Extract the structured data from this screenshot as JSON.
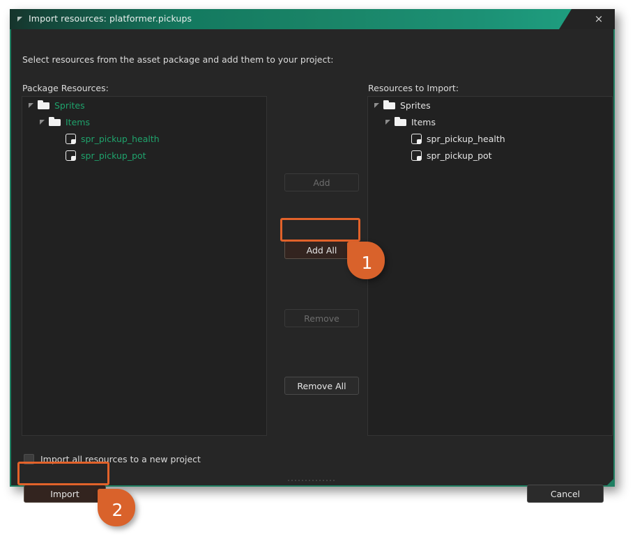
{
  "window": {
    "title": "Import resources: platformer.pickups",
    "menu_icon": "window-menu-triangle-icon",
    "close_icon": "×"
  },
  "body": {
    "instruction": "Select resources from the asset package and add them to your project:"
  },
  "panels": {
    "left": {
      "label": "Package Resources:",
      "items": [
        {
          "label": "Sprites",
          "icon": "folder-icon",
          "depth": 0,
          "expanded": true,
          "color": "green"
        },
        {
          "label": "Items",
          "icon": "folder-icon",
          "depth": 1,
          "expanded": true,
          "color": "green"
        },
        {
          "label": "spr_pickup_health",
          "icon": "sprite-icon",
          "depth": 2,
          "expanded": false,
          "color": "green"
        },
        {
          "label": "spr_pickup_pot",
          "icon": "sprite-icon",
          "depth": 2,
          "expanded": false,
          "color": "green"
        }
      ]
    },
    "right": {
      "label": "Resources to Import:",
      "items": [
        {
          "label": "Sprites",
          "icon": "folder-icon",
          "depth": 0,
          "expanded": true,
          "color": "white"
        },
        {
          "label": "Items",
          "icon": "folder-icon",
          "depth": 1,
          "expanded": true,
          "color": "white"
        },
        {
          "label": "spr_pickup_health",
          "icon": "sprite-icon",
          "depth": 2,
          "expanded": false,
          "color": "white"
        },
        {
          "label": "spr_pickup_pot",
          "icon": "sprite-icon",
          "depth": 2,
          "expanded": false,
          "color": "white"
        }
      ]
    }
  },
  "transfer_buttons": {
    "add": {
      "label": "Add",
      "enabled": false
    },
    "add_all": {
      "label": "Add All",
      "enabled": true,
      "highlighted": true
    },
    "remove": {
      "label": "Remove",
      "enabled": false
    },
    "remove_all": {
      "label": "Remove All",
      "enabled": true
    }
  },
  "options": {
    "import_all_new_project": {
      "label": "Import all resources to a new project",
      "checked": false
    }
  },
  "footer": {
    "import": {
      "label": "Import",
      "highlighted": true
    },
    "cancel": {
      "label": "Cancel"
    }
  },
  "callouts": [
    {
      "number": "1",
      "target": "add-all-button"
    },
    {
      "number": "2",
      "target": "import-button"
    }
  ],
  "colors": {
    "accent_green": "#1f7f62",
    "titlebar_green": "#1a8467",
    "tree_green_text": "#1fa36c",
    "highlight_orange": "#e2622a",
    "badge_orange": "#d9622b",
    "panel_bg": "#212121",
    "dialog_bg": "#262626"
  }
}
